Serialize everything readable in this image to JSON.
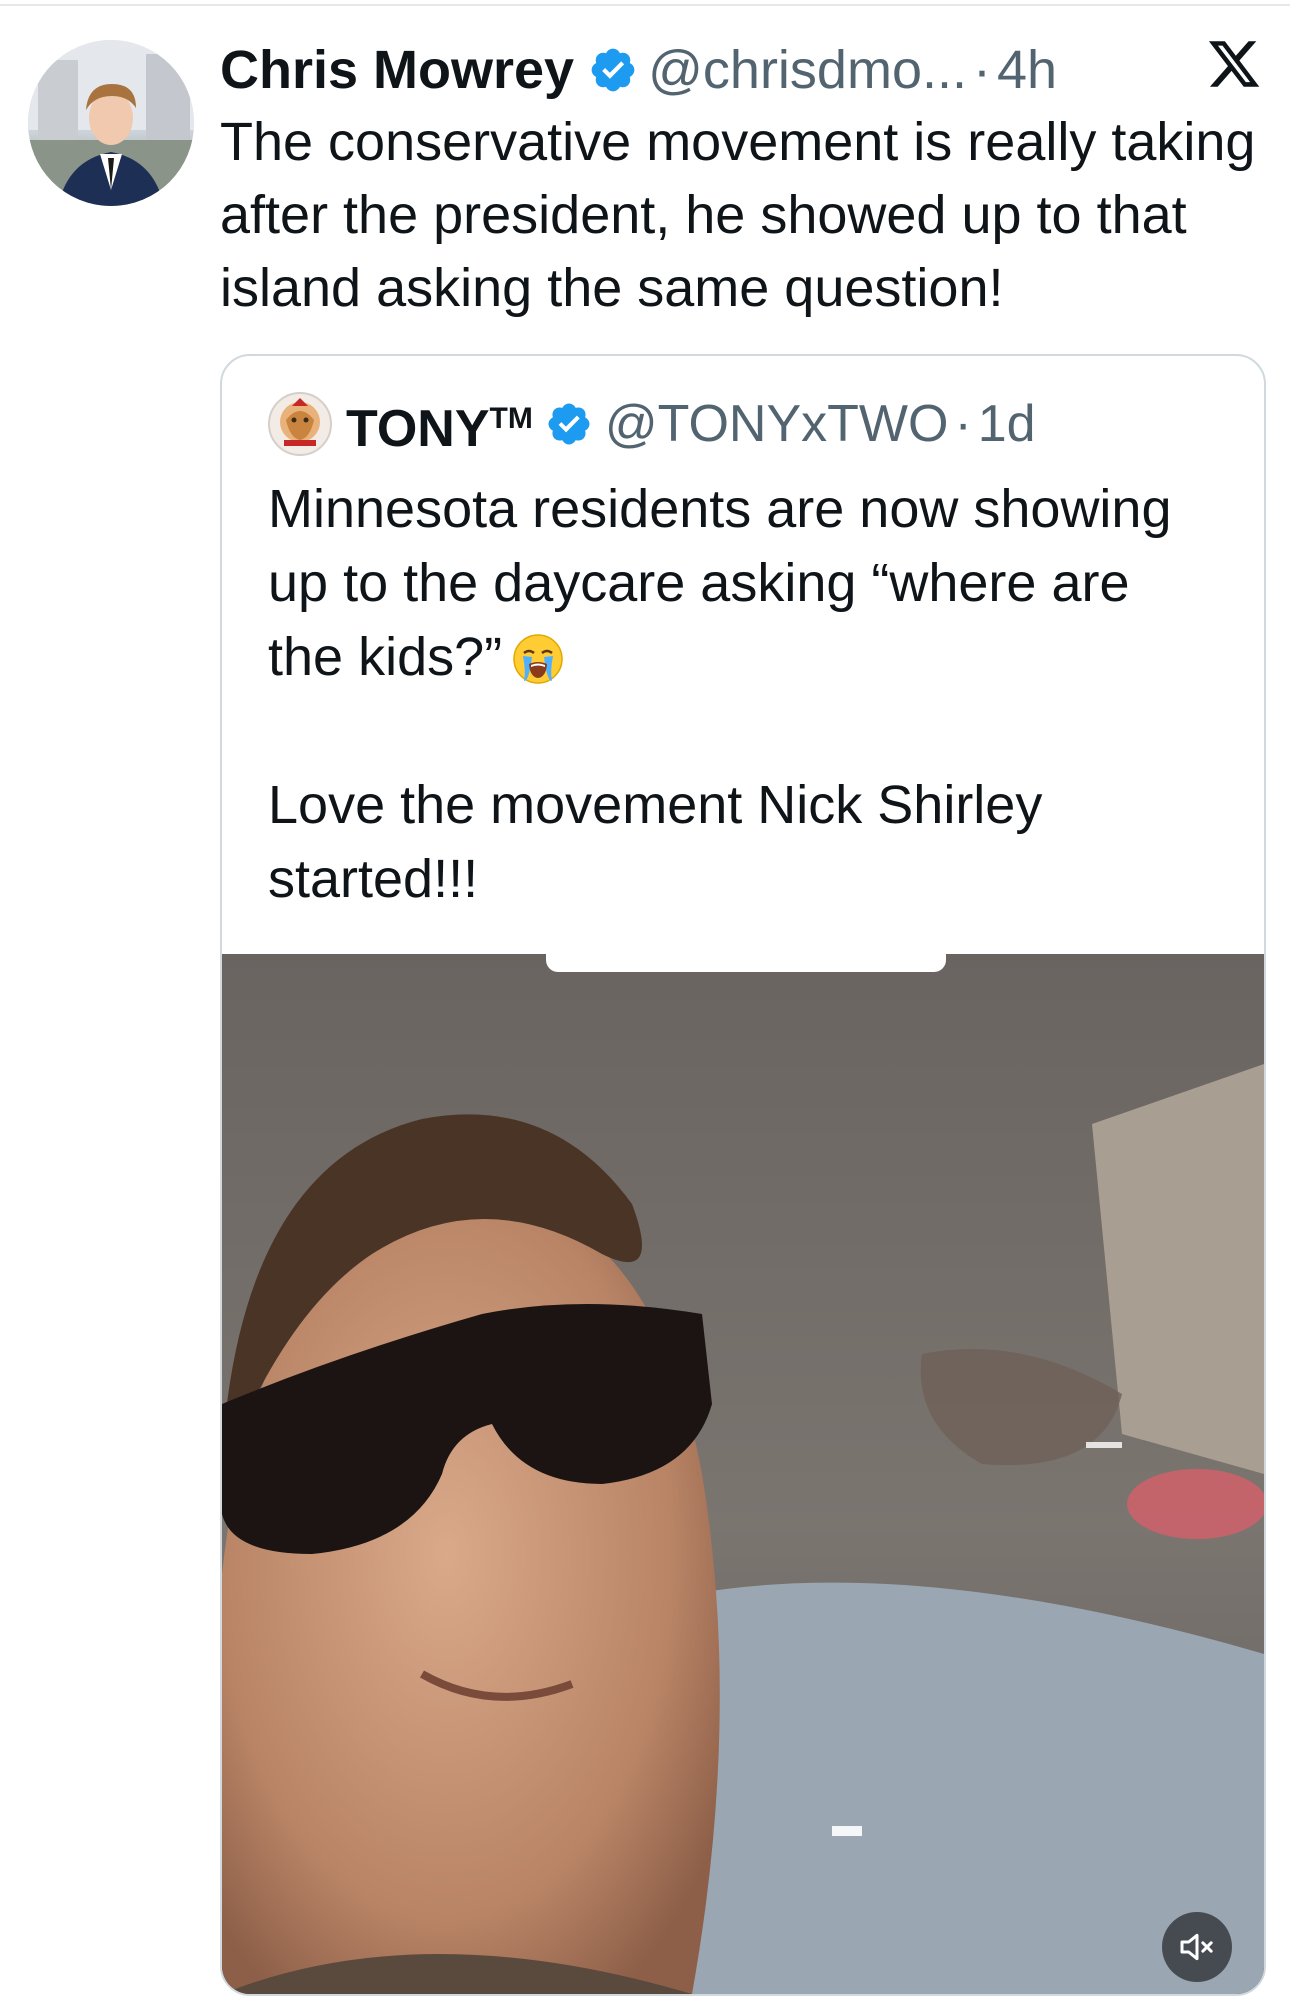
{
  "tweet": {
    "author_name": "Chris Mowrey",
    "handle": "@chrisdmo...",
    "separator": "·",
    "time": "4h",
    "text": "The conservative movement is really taking after the president, he showed up to that island asking the same question!"
  },
  "quoted": {
    "author_name": "TONY",
    "author_suffix": "TM",
    "handle": "@TONYxTWO",
    "separator": "·",
    "time": "1d",
    "paragraph_1": "Minnesota residents are now showing up to the daycare asking “where are the kids?”",
    "paragraph_2": "Love the movement Nick Shirley started!!!",
    "emoji": "loudly-crying-face"
  },
  "icons": {
    "verified": "verified-badge-icon",
    "brand": "x-logo-icon",
    "mute": "volume-muted-icon"
  },
  "colors": {
    "verified_blue": "#1d9bf0",
    "secondary_text": "#536471",
    "primary_text": "#0f1419",
    "border": "#cfd9de"
  }
}
